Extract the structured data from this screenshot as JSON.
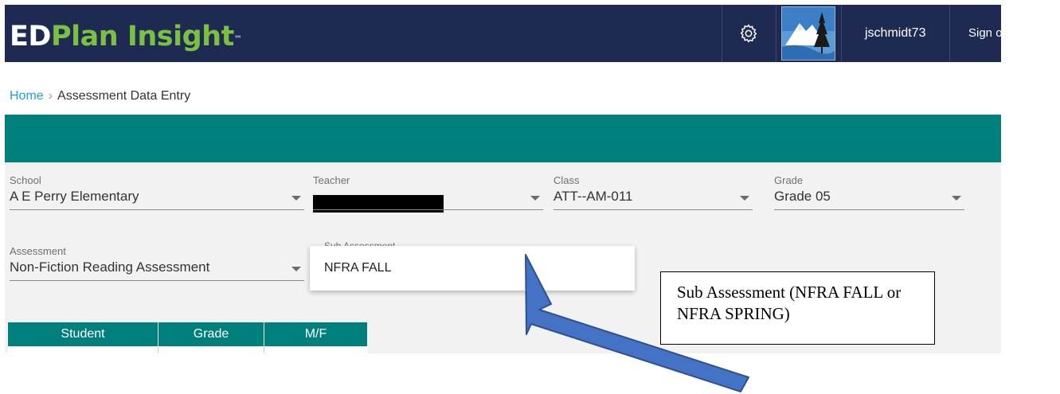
{
  "header": {
    "logo": {
      "part_ed": "ED",
      "part_plan": "Plan Insight",
      "trademark": "™"
    },
    "settings_icon": "gear-icon",
    "username": "jschmidt73",
    "sign_out": "Sign out"
  },
  "breadcrumb": {
    "home": "Home",
    "separator": "›",
    "current": "Assessment Data Entry"
  },
  "filters": {
    "school": {
      "label": "School",
      "value": "A E Perry Elementary"
    },
    "teacher": {
      "label": "Teacher",
      "value": ""
    },
    "class": {
      "label": "Class",
      "value": "ATT--AM-011"
    },
    "grade": {
      "label": "Grade",
      "value": "Grade 05"
    },
    "assessment": {
      "label": "Assessment",
      "value": "Non-Fiction Reading Assessment"
    },
    "sub_assessment": {
      "label": "Sub Assessment",
      "options": [
        "NFRA FALL"
      ]
    }
  },
  "table": {
    "columns": [
      "Student",
      "Grade",
      "M/F"
    ]
  },
  "callout": {
    "line1": "Sub Assessment (NFRA FALL or",
    "line2": "NFRA SPRING)"
  },
  "colors": {
    "header_bg": "#1f2a52",
    "accent_teal": "#00807c",
    "logo_green": "#7ac143",
    "arrow_blue": "#4472c4"
  }
}
